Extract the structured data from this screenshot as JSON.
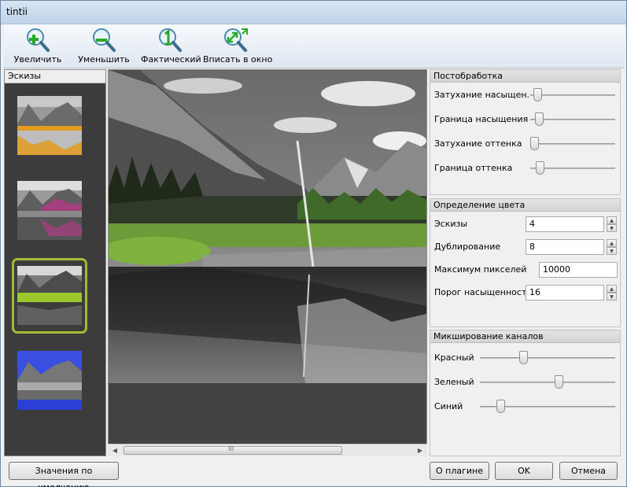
{
  "window": {
    "title": "tintii"
  },
  "toolbar": {
    "zoom_in": "Увеличить",
    "zoom_out": "Уменьшить",
    "actual_size": "Фактический",
    "fit_window": "Вписать в окно"
  },
  "thumbnails": {
    "header": "Эскизы",
    "items": [
      {
        "accent": "#e39b1e",
        "selected": false
      },
      {
        "accent": "#a3407e",
        "selected": false
      },
      {
        "accent": "#9bc82a",
        "selected": true
      },
      {
        "accent": "#3a4fe0",
        "selected": false
      }
    ]
  },
  "postprocessing": {
    "header": "Постобработка",
    "sliders": [
      {
        "label": "Затухание насыщен.",
        "value": 0.04
      },
      {
        "label": "Граница насыщения",
        "value": 0.06
      },
      {
        "label": "Затухание оттенка",
        "value": 0.0
      },
      {
        "label": "Граница оттенка",
        "value": 0.07
      }
    ]
  },
  "color_detection": {
    "header": "Определение цвета",
    "fields": [
      {
        "label": "Эскизы",
        "value": "4"
      },
      {
        "label": "Дублирование",
        "value": "8"
      },
      {
        "label": "Максимум пикселей",
        "value": "10000"
      },
      {
        "label": "Порог насыщенности",
        "value": "16"
      }
    ]
  },
  "channel_mixing": {
    "header": "Микширование каналов",
    "sliders": [
      {
        "label": "Красный",
        "value": 0.31
      },
      {
        "label": "Зеленый",
        "value": 0.59
      },
      {
        "label": "Синий",
        "value": 0.13
      }
    ]
  },
  "buttons": {
    "defaults": "Значения по умолчанию",
    "about": "О плагине",
    "ok": "OK",
    "cancel": "Отмена"
  },
  "scrollbar": {
    "grip": "III"
  }
}
